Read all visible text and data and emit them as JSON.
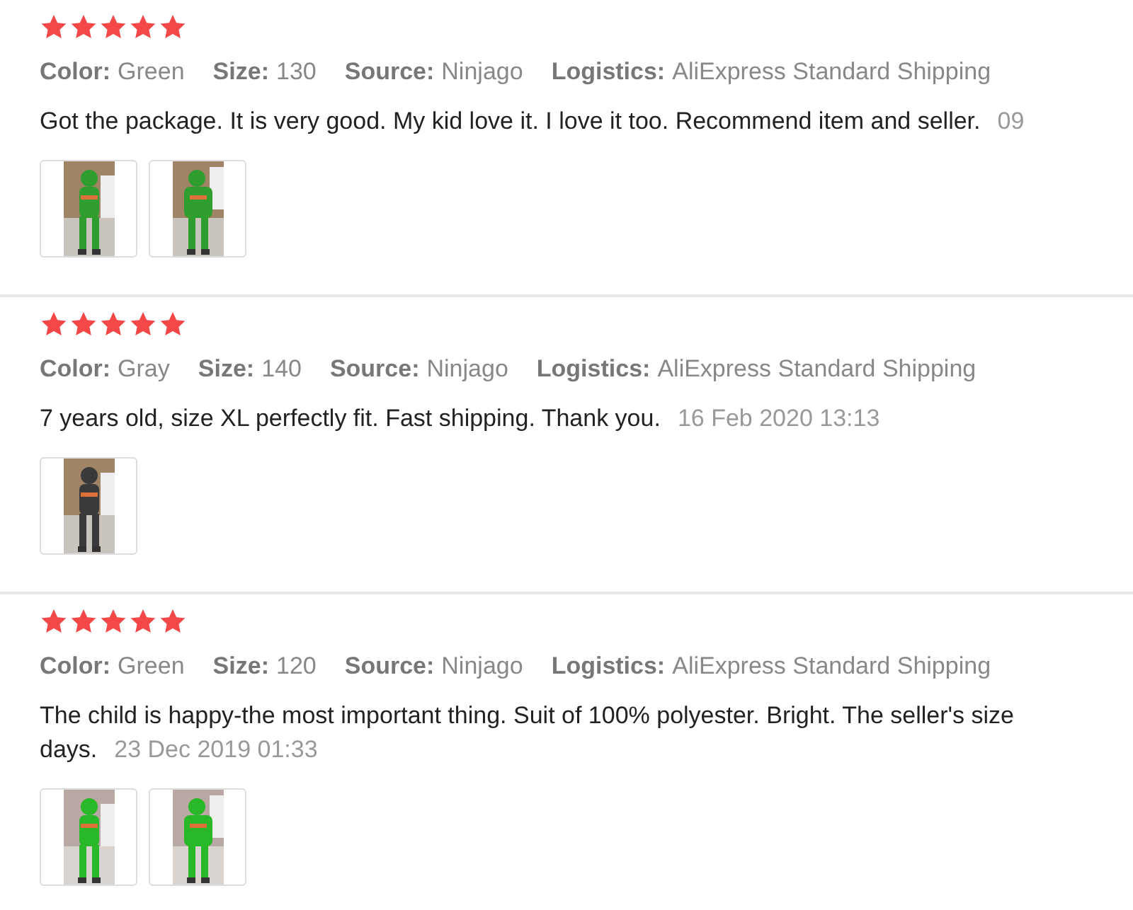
{
  "reviews": [
    {
      "stars": 5,
      "meta": [
        {
          "label": "Color:",
          "value": "Green"
        },
        {
          "label": "Size:",
          "value": "130"
        },
        {
          "label": "Source:",
          "value": "Ninjago"
        },
        {
          "label": "Logistics:",
          "value": "AliExpress Standard Shipping"
        }
      ],
      "text_lines": [
        "Got the package. It is very good. My kid love it. I love it too. Recommend item and seller."
      ],
      "date": "09",
      "photos": [
        {
          "kind": "picture"
        },
        {
          "kind": "picture"
        }
      ]
    },
    {
      "stars": 5,
      "meta": [
        {
          "label": "Color:",
          "value": "Gray"
        },
        {
          "label": "Size:",
          "value": "140"
        },
        {
          "label": "Source:",
          "value": "Ninjago"
        },
        {
          "label": "Logistics:",
          "value": "AliExpress Standard Shipping"
        }
      ],
      "text_lines": [
        "7 years old, size XL perfectly fit. Fast shipping. Thank you."
      ],
      "date": "16 Feb 2020 13:13",
      "photos": [
        {
          "kind": "picture"
        }
      ]
    },
    {
      "stars": 5,
      "meta": [
        {
          "label": "Color:",
          "value": "Green"
        },
        {
          "label": "Size:",
          "value": "120"
        },
        {
          "label": "Source:",
          "value": "Ninjago"
        },
        {
          "label": "Logistics:",
          "value": "AliExpress Standard Shipping"
        }
      ],
      "text_lines": [
        "The child is happy-the most important thing. Suit of 100% polyester. Bright. The seller's size",
        "days."
      ],
      "date": "23 Dec 2019 01:33",
      "photos": [
        {
          "kind": "picture"
        },
        {
          "kind": "picture"
        }
      ]
    }
  ]
}
